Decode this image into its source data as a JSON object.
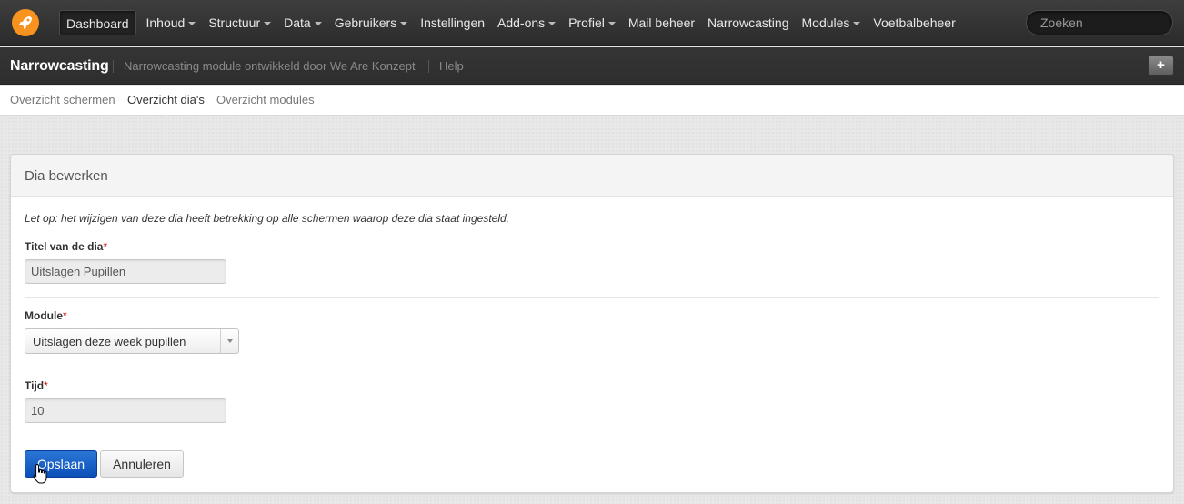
{
  "topbar": {
    "nav": [
      {
        "label": "Dashboard",
        "active": true,
        "dropdown": false
      },
      {
        "label": "Inhoud",
        "dropdown": true
      },
      {
        "label": "Structuur",
        "dropdown": true
      },
      {
        "label": "Data",
        "dropdown": true
      },
      {
        "label": "Gebruikers",
        "dropdown": true
      },
      {
        "label": "Instellingen",
        "dropdown": false
      },
      {
        "label": "Add-ons",
        "dropdown": true
      },
      {
        "label": "Profiel",
        "dropdown": true
      },
      {
        "label": "Mail beheer",
        "dropdown": false
      },
      {
        "label": "Narrowcasting",
        "dropdown": false
      },
      {
        "label": "Modules",
        "dropdown": true
      },
      {
        "label": "Voetbalbeheer",
        "dropdown": false
      }
    ],
    "search_placeholder": "Zoeken"
  },
  "subbar": {
    "title": "Narrowcasting",
    "description": "Narrowcasting module ontwikkeld door We Are Konzept",
    "help": "Help",
    "plus_label": "+"
  },
  "tabs": [
    {
      "label": "Overzicht schermen",
      "active": false
    },
    {
      "label": "Overzicht dia's",
      "active": true
    },
    {
      "label": "Overzicht modules",
      "active": false
    }
  ],
  "panel": {
    "title": "Dia bewerken",
    "notice": "Let op: het wijzigen van deze dia heeft betrekking op alle schermen waarop deze dia staat ingesteld.",
    "fields": {
      "title_label": "Titel van de dia",
      "title_value": "Uitslagen Pupillen",
      "module_label": "Module",
      "module_value": "Uitslagen deze week pupillen",
      "time_label": "Tijd",
      "time_value": "10",
      "required_mark": "*"
    },
    "buttons": {
      "save": "Opslaan",
      "cancel": "Annuleren"
    }
  },
  "colors": {
    "accent": "#f7931e",
    "primary_button": "#1a62c8",
    "required": "#cc0000"
  }
}
